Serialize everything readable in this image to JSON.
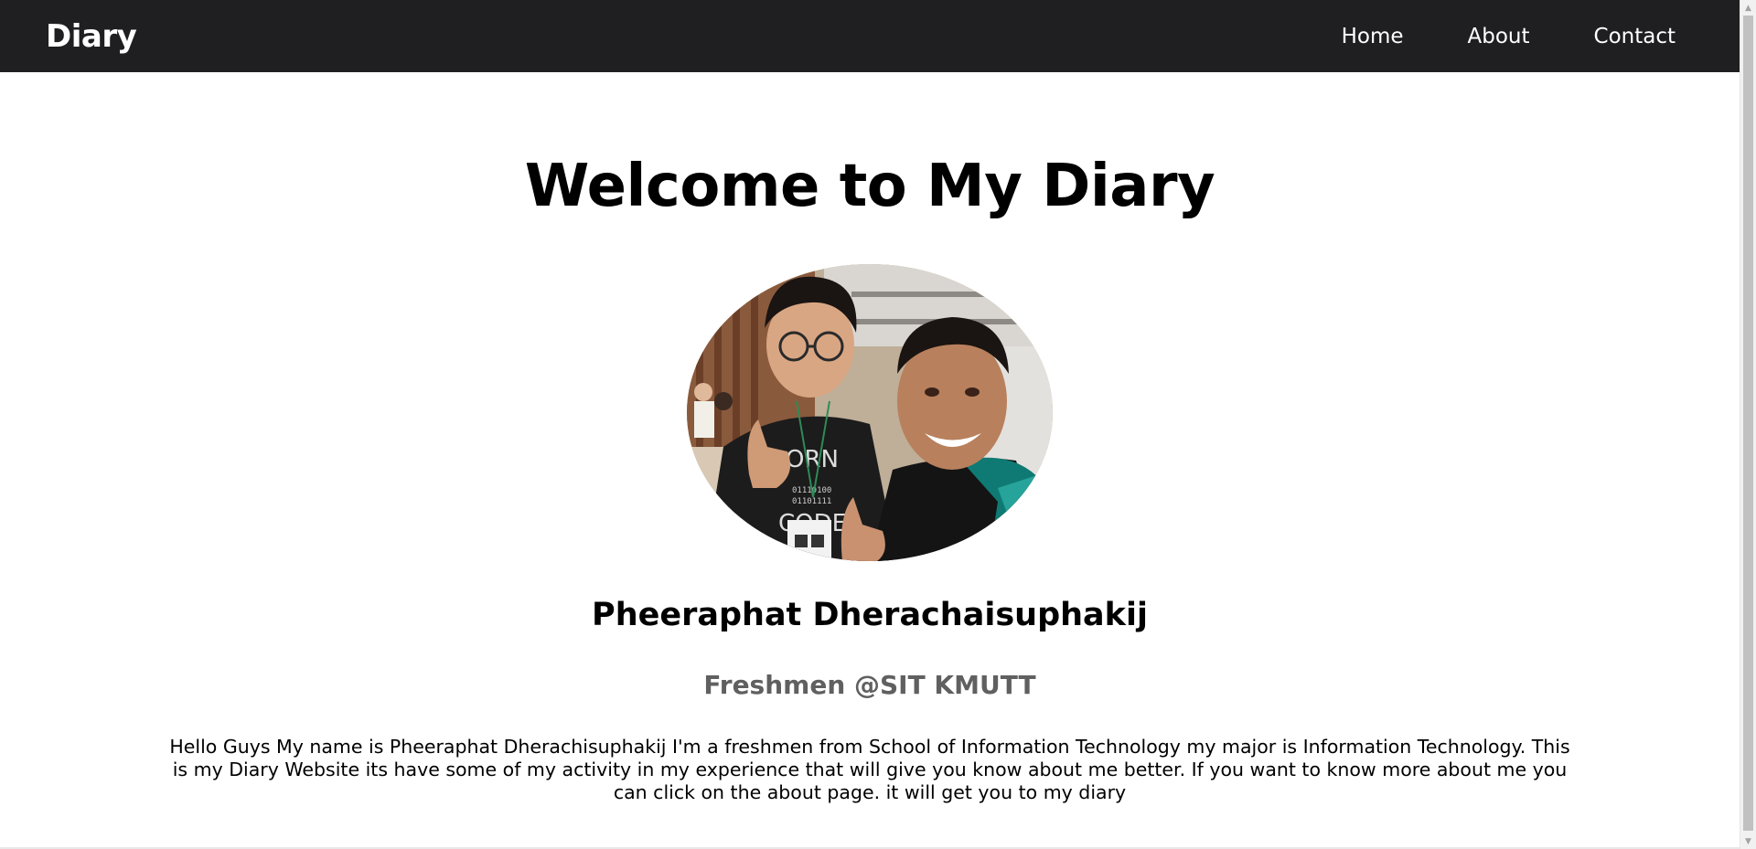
{
  "navbar": {
    "brand": "Diary",
    "links": [
      {
        "label": "Home"
      },
      {
        "label": "About"
      },
      {
        "label": "Contact"
      }
    ]
  },
  "hero": {
    "title": "Welcome to My Diary",
    "avatar_icon": "profile-photo",
    "name": "Pheeraphat Dherachaisuphakij",
    "role": "Freshmen @SIT KMUTT",
    "bio": "Hello Guys My name is Pheeraphat Dherachisuphakij I'm a freshmen from School of Information Technology my major is Information Technology. This is my Diary Website its have some of my activity in my experience that will give you know about me better. If you want to know more about me you can click on the about page. it will get you to my diary"
  },
  "colors": {
    "navbar_bg": "#1f1f21",
    "nav_text": "#ffffff",
    "role_text": "#606060",
    "page_bg": "#ffffff"
  }
}
